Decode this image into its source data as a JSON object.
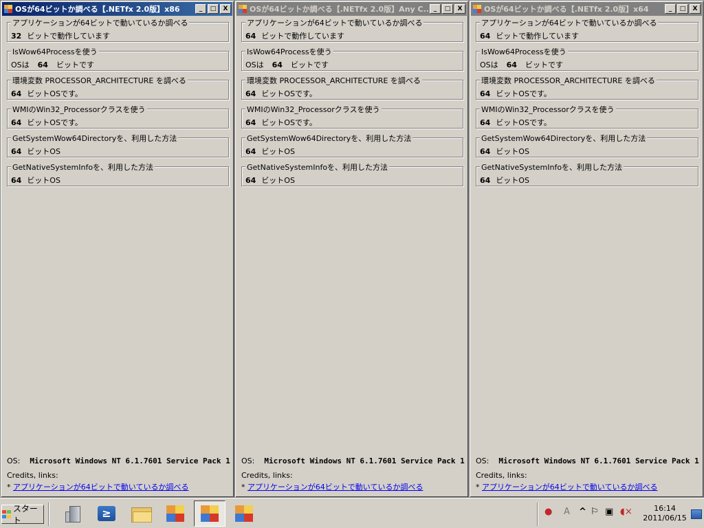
{
  "windows": [
    {
      "title": "OSが64ビットか調べる【.NETfx 2.0版】x86",
      "active": true,
      "groups": [
        {
          "label": "アプリケーションが64ビットで動いているか調べる",
          "num": "32",
          "text": "ビットで動作しています",
          "prefix": ""
        },
        {
          "label": "IsWow64Processを使う",
          "prefix": "OSは",
          "num": "64",
          "text": "ビットです"
        },
        {
          "label": "環境変数 PROCESSOR_ARCHITECTURE を調べる",
          "prefix": "",
          "num": "64",
          "text": "ビットOSです。"
        },
        {
          "label": "WMIのWin32_Processorクラスを使う",
          "prefix": "",
          "num": "64",
          "text": "ビットOSです。"
        },
        {
          "label": "GetSystemWow64Directoryを、利用した方法",
          "prefix": "",
          "num": "64",
          "text": "ビットOS"
        },
        {
          "label": "GetNativeSystemInfoを、利用した方法",
          "prefix": "",
          "num": "64",
          "text": "ビットOS"
        }
      ],
      "os_label": "OS:",
      "os_value": "Microsoft Windows NT 6.1.7601 Service Pack 1",
      "credits": "Credits, links:",
      "link_bullet": "*",
      "link_text": "アプリケーションが64ビットで動いているか調べる"
    },
    {
      "title": "OSが64ビットか調べる【.NETfx 2.0版】Any C...",
      "active": false,
      "groups": [
        {
          "label": "アプリケーションが64ビットで動いているか調べる",
          "prefix": "",
          "num": "64",
          "text": "ビットで動作しています"
        },
        {
          "label": "IsWow64Processを使う",
          "prefix": "OSは",
          "num": "64",
          "text": "ビットです"
        },
        {
          "label": "環境変数 PROCESSOR_ARCHITECTURE を調べる",
          "prefix": "",
          "num": "64",
          "text": "ビットOSです。"
        },
        {
          "label": "WMIのWin32_Processorクラスを使う",
          "prefix": "",
          "num": "64",
          "text": "ビットOSです。"
        },
        {
          "label": "GetSystemWow64Directoryを、利用した方法",
          "prefix": "",
          "num": "64",
          "text": "ビットOS"
        },
        {
          "label": "GetNativeSystemInfoを、利用した方法",
          "prefix": "",
          "num": "64",
          "text": "ビットOS"
        }
      ],
      "os_label": "OS:",
      "os_value": "Microsoft Windows NT 6.1.7601 Service Pack 1",
      "credits": "Credits, links:",
      "link_bullet": "*",
      "link_text": "アプリケーションが64ビットで動いているか調べる"
    },
    {
      "title": "OSが64ビットか調べる【.NETfx 2.0版】x64",
      "active": false,
      "groups": [
        {
          "label": "アプリケーションが64ビットで動いているか調べる",
          "prefix": "",
          "num": "64",
          "text": "ビットで動作しています"
        },
        {
          "label": "IsWow64Processを使う",
          "prefix": "OSは",
          "num": "64",
          "text": "ビットです"
        },
        {
          "label": "環境変数 PROCESSOR_ARCHITECTURE を調べる",
          "prefix": "",
          "num": "64",
          "text": "ビットOSです。"
        },
        {
          "label": "WMIのWin32_Processorクラスを使う",
          "prefix": "",
          "num": "64",
          "text": "ビットOSです。"
        },
        {
          "label": "GetSystemWow64Directoryを、利用した方法",
          "prefix": "",
          "num": "64",
          "text": "ビットOS"
        },
        {
          "label": "GetNativeSystemInfoを、利用した方法",
          "prefix": "",
          "num": "64",
          "text": "ビットOS"
        }
      ],
      "os_label": "OS:",
      "os_value": "Microsoft Windows NT 6.1.7601 Service Pack 1",
      "credits": "Credits, links:",
      "link_bullet": "*",
      "link_text": "アプリケーションが64ビットで動いているか調べる"
    }
  ],
  "title_buttons": {
    "minimize": "_",
    "maximize": "□",
    "close": "X"
  },
  "taskbar": {
    "start_label": "スタート",
    "tasks": [
      {
        "icon": "server-manager-icon"
      },
      {
        "icon": "powershell-icon",
        "glyph": "≥"
      },
      {
        "icon": "explorer-folder-icon"
      },
      {
        "icon": "app-icon"
      },
      {
        "icon": "app-icon"
      },
      {
        "icon": "app-icon"
      }
    ],
    "tray": {
      "ime": "A",
      "expand": "^",
      "time": "16:14",
      "date": "2011/06/15"
    }
  }
}
